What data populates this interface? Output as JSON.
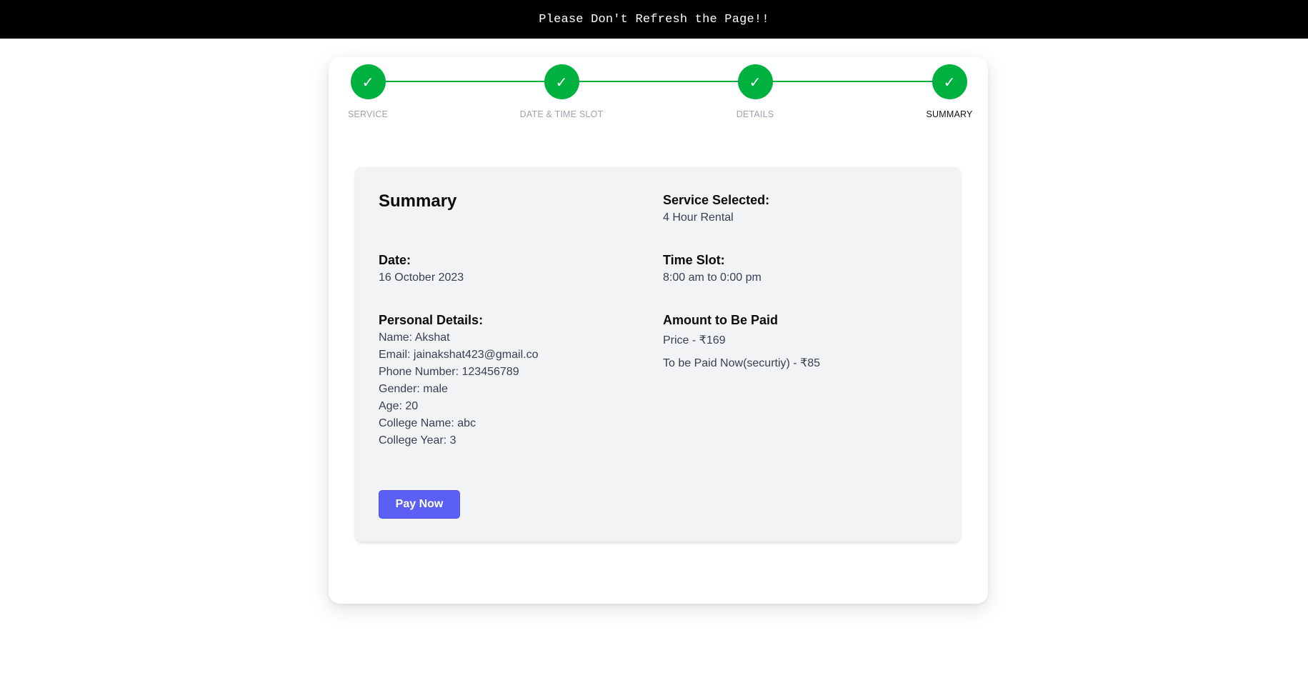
{
  "banner": {
    "text": "Please Don't Refresh the Page!!"
  },
  "stepper": {
    "check_glyph": "✓",
    "steps": [
      {
        "label": "SERVICE",
        "state": "complete"
      },
      {
        "label": "DATE & TIME SLOT",
        "state": "complete"
      },
      {
        "label": "DETAILS",
        "state": "complete"
      },
      {
        "label": "SUMMARY",
        "state": "active"
      }
    ],
    "complete_color": "#00b140"
  },
  "summary": {
    "title": "Summary",
    "service": {
      "heading": "Service Selected:",
      "value": "4 Hour Rental"
    },
    "date": {
      "heading": "Date:",
      "value": "16 October 2023"
    },
    "time_slot": {
      "heading": "Time Slot:",
      "value": "8:00 am to 0:00 pm"
    },
    "personal_details": {
      "heading": "Personal Details:",
      "lines": [
        "Name: Akshat",
        "Email: jainakshat423@gmail.co",
        "Phone Number: 123456789",
        "Gender: male",
        "Age: 20",
        "College Name: abc",
        "College Year: 3"
      ]
    },
    "amount": {
      "heading": "Amount to Be Paid",
      "price": "Price - ₹169",
      "pay_now": "To be Paid Now(securtiy) - ₹85"
    },
    "pay_button_label": "Pay Now"
  },
  "colors": {
    "accent": "#5b5ff4",
    "success": "#00b140",
    "panel": "#f2f3f5"
  }
}
